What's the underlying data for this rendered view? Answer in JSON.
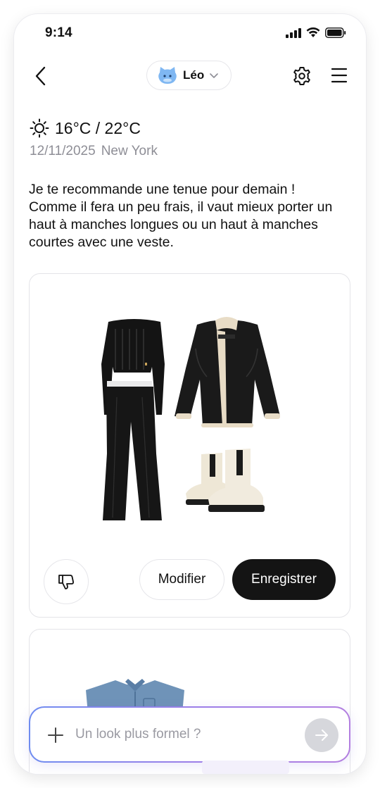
{
  "status_bar": {
    "time": "9:14"
  },
  "header": {
    "profile_name": "Léo"
  },
  "weather": {
    "temperature": "16°C / 22°C",
    "date": "12/11/2025",
    "location": "New York"
  },
  "recommendation": {
    "text": "Je te recommande une tenue pour demain ! Comme il fera un peu frais, il vaut mieux porter un haut à manches longues ou un haut à manches courtes avec une veste."
  },
  "outfit_card": {
    "items": [
      "black-knit-top",
      "black-shearling-jacket",
      "black-flared-pants",
      "cream-chelsea-boots"
    ],
    "modify_label": "Modifier",
    "save_label": "Enregistrer"
  },
  "composer": {
    "placeholder": "Un look plus formel ?"
  },
  "colors": {
    "primary_button": "#141414",
    "composer_gradient_start": "#6f8cf0",
    "composer_gradient_end": "#b37fe0",
    "muted_text": "#8e8e96"
  }
}
